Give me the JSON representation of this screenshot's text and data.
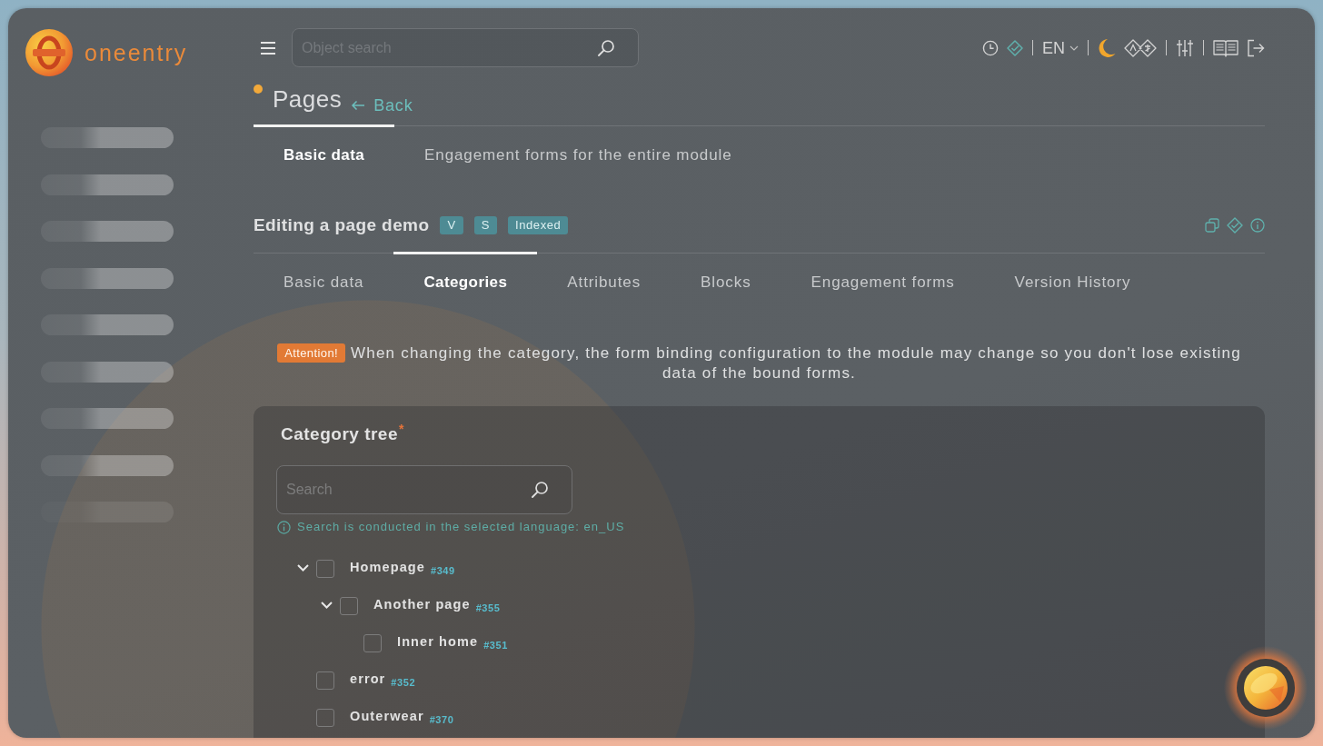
{
  "logo": {
    "text": "oneentry"
  },
  "sidebar": {
    "items": [
      {
        "kind": "placeholder"
      },
      {
        "kind": "placeholder"
      },
      {
        "kind": "placeholder"
      },
      {
        "kind": "placeholder"
      },
      {
        "kind": "placeholder"
      },
      {
        "kind": "placeholder"
      },
      {
        "kind": "placeholder"
      },
      {
        "kind": "placeholder"
      },
      {
        "kind": "fading"
      }
    ]
  },
  "top_bar": {
    "search": {
      "placeholder": "Object search"
    },
    "language": "EN"
  },
  "page_header": {
    "title": "Pages",
    "back_link": "Back"
  },
  "module_tabs": [
    {
      "label": "Basic data",
      "selected": true
    },
    {
      "label": "Engagement forms for the entire module",
      "selected": false
    }
  ],
  "editor": {
    "title": "Editing a page demo",
    "badges": [
      "V",
      "S",
      "Indexed"
    ]
  },
  "page_tabs": [
    {
      "label": "Basic data",
      "selected": false
    },
    {
      "label": "Categories",
      "selected": true
    },
    {
      "label": "Attributes",
      "selected": false
    },
    {
      "label": "Blocks",
      "selected": false
    },
    {
      "label": "Engagement forms",
      "selected": false
    },
    {
      "label": "Version History",
      "selected": false
    }
  ],
  "notice": {
    "badge": "Attention!",
    "text": "When changing the category, the form binding configuration to the module may change so you don't lose existing data of the bound forms."
  },
  "category_tree": {
    "title": "Category tree",
    "required_mark": "*",
    "search": {
      "placeholder": "Search"
    },
    "hint": "Search is conducted in the selected language: en_US",
    "items": [
      {
        "label": "Homepage",
        "id": "#349",
        "checked": false,
        "expanded": true,
        "children": [
          {
            "label": "Another page",
            "id": "#355",
            "checked": false,
            "expanded": true,
            "children": [
              {
                "label": "Inner home",
                "id": "#351",
                "checked": false
              }
            ]
          }
        ]
      },
      {
        "label": "error",
        "id": "#352",
        "checked": false
      },
      {
        "label": "Outerwear",
        "id": "#370",
        "checked": false
      }
    ]
  }
}
